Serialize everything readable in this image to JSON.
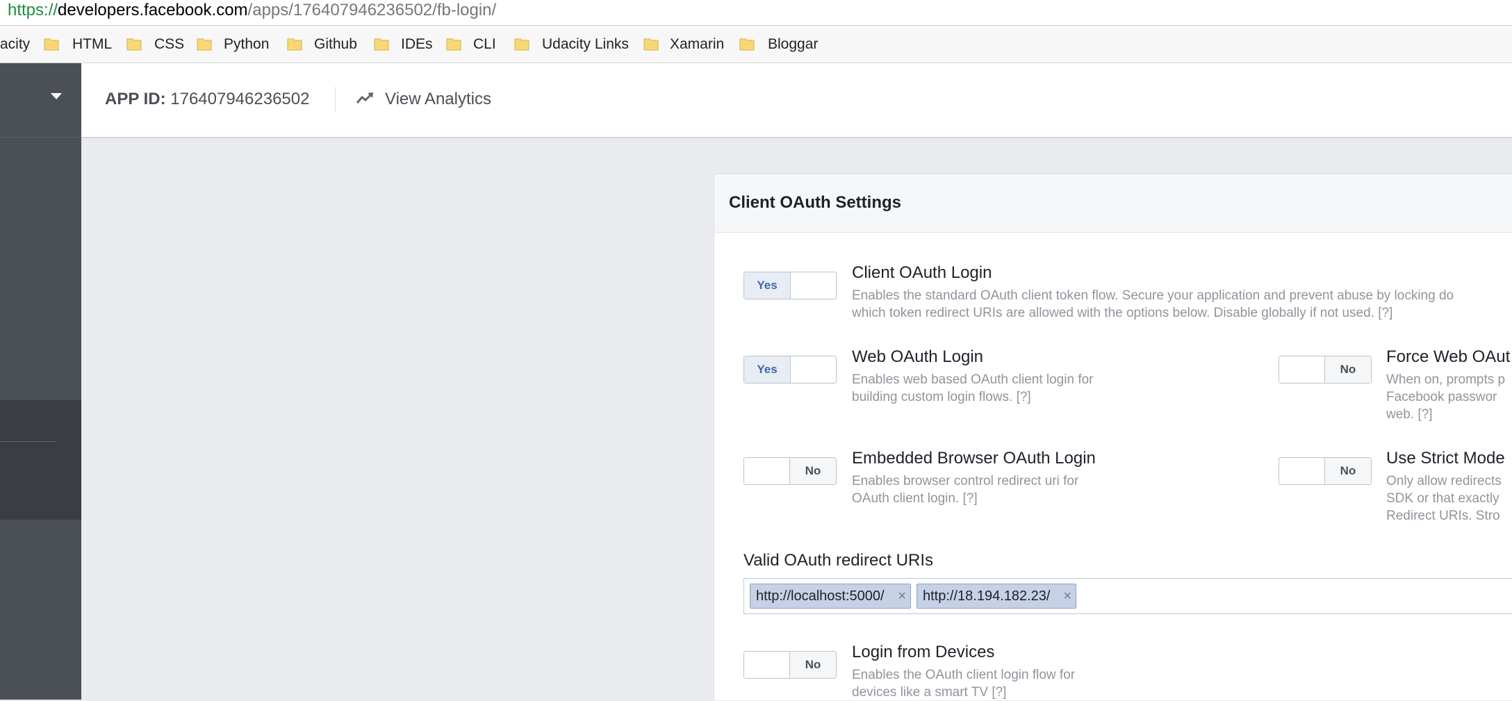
{
  "browser": {
    "url_scheme": "https://",
    "url_host": "developers.facebook.com",
    "url_path": "/apps/176407946236502/fb-login/"
  },
  "bookmarks": [
    "acity",
    "HTML",
    "CSS",
    "Python",
    "Github",
    "IDEs",
    "CLI",
    "Udacity Links",
    "Xamarin",
    "Bloggar"
  ],
  "header": {
    "app_id_label": "APP ID:",
    "app_id_value": "176407946236502",
    "analytics_label": "View Analytics"
  },
  "card": {
    "title": "Client OAuth Settings",
    "options": [
      {
        "title": "Client OAuth Login",
        "state": "Yes",
        "desc1": "Enables the standard OAuth client token flow. Secure your application and prevent abuse by locking do",
        "desc2": "which token redirect URIs are allowed with the options below. Disable globally if not used.  [?]"
      },
      {
        "title": "Web OAuth Login",
        "state": "Yes",
        "desc1": "Enables web based OAuth client login for",
        "desc2": "building custom login flows.  [?]"
      },
      {
        "title": "Force Web OAut",
        "state": "No",
        "desc1": "When on, prompts p",
        "desc2": "Facebook passwor",
        "desc3": "web.  [?]"
      },
      {
        "title": "Embedded Browser OAuth Login",
        "state": "No",
        "desc1": "Enables browser control redirect uri for",
        "desc2": "OAuth client login.  [?]"
      },
      {
        "title": "Use Strict Mode",
        "state": "No",
        "desc1": "Only allow redirects",
        "desc2": "SDK or that exactly",
        "desc3": "Redirect URIs. Stro"
      },
      {
        "title": "Login from Devices",
        "state": "No",
        "desc1": "Enables the OAuth client login flow for",
        "desc2": "devices like a smart TV  [?]"
      }
    ],
    "redirect_label": "Valid OAuth redirect URIs",
    "redirect_uris": [
      "http://localhost:5000/",
      "http://18.194.182.23/"
    ],
    "remove_glyph": "×"
  },
  "colors": {
    "sidebar": "#4b4f56",
    "link_blue": "#4267b2",
    "page_bg": "#e9ebee"
  }
}
